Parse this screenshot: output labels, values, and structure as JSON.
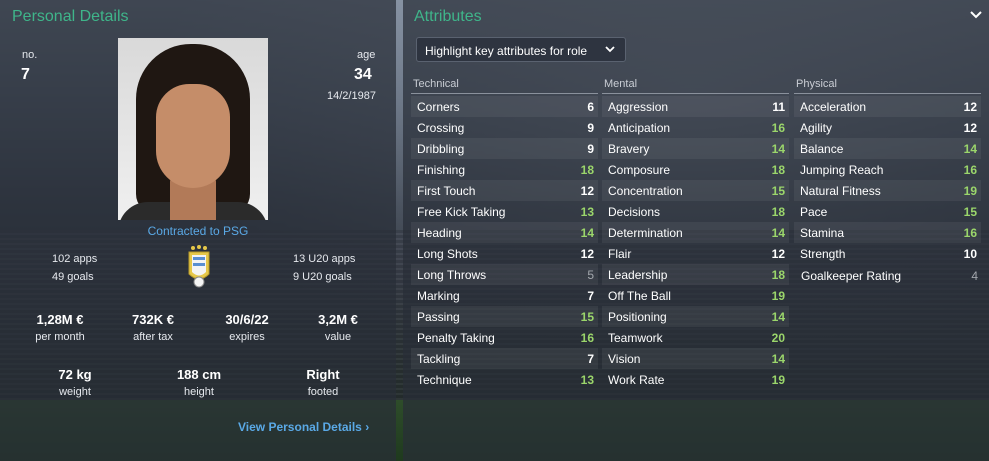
{
  "personal": {
    "title": "Personal Details",
    "number_label": "no.",
    "number": "7",
    "age_label": "age",
    "age": "34",
    "dob": "14/2/1987",
    "contract": "Contracted to PSG",
    "apps": "102 apps",
    "goals": "49 goals",
    "u20_apps": "13 U20 apps",
    "u20_goals": "9 U20 goals",
    "wage_value": "1,28M €",
    "wage_label": "per month",
    "aftertax_value": "732K €",
    "aftertax_label": "after tax",
    "expires_value": "30/6/22",
    "expires_label": "expires",
    "value_value": "3,2M €",
    "value_label": "value",
    "weight_value": "72 kg",
    "weight_label": "weight",
    "height_value": "188 cm",
    "height_label": "height",
    "footed_value": "Right",
    "footed_label": "footed",
    "view_link": "View Personal Details",
    "chevron": "›"
  },
  "attributes": {
    "title": "Attributes",
    "dropdown_label": "Highlight key attributes for role",
    "columns": [
      {
        "header": "Technical",
        "rows": [
          {
            "name": "Corners",
            "value": "6"
          },
          {
            "name": "Crossing",
            "value": "9"
          },
          {
            "name": "Dribbling",
            "value": "9"
          },
          {
            "name": "Finishing",
            "value": "18"
          },
          {
            "name": "First Touch",
            "value": "12"
          },
          {
            "name": "Free Kick Taking",
            "value": "13"
          },
          {
            "name": "Heading",
            "value": "14"
          },
          {
            "name": "Long Shots",
            "value": "12"
          },
          {
            "name": "Long Throws",
            "value": "5"
          },
          {
            "name": "Marking",
            "value": "7"
          },
          {
            "name": "Passing",
            "value": "15"
          },
          {
            "name": "Penalty Taking",
            "value": "16"
          },
          {
            "name": "Tackling",
            "value": "7"
          },
          {
            "name": "Technique",
            "value": "13"
          }
        ]
      },
      {
        "header": "Mental",
        "rows": [
          {
            "name": "Aggression",
            "value": "11"
          },
          {
            "name": "Anticipation",
            "value": "16"
          },
          {
            "name": "Bravery",
            "value": "14"
          },
          {
            "name": "Composure",
            "value": "18"
          },
          {
            "name": "Concentration",
            "value": "15"
          },
          {
            "name": "Decisions",
            "value": "18"
          },
          {
            "name": "Determination",
            "value": "14"
          },
          {
            "name": "Flair",
            "value": "12"
          },
          {
            "name": "Leadership",
            "value": "18"
          },
          {
            "name": "Off The Ball",
            "value": "19"
          },
          {
            "name": "Positioning",
            "value": "14"
          },
          {
            "name": "Teamwork",
            "value": "20"
          },
          {
            "name": "Vision",
            "value": "14"
          },
          {
            "name": "Work Rate",
            "value": "19"
          }
        ]
      },
      {
        "header": "Physical",
        "rows": [
          {
            "name": "Acceleration",
            "value": "12"
          },
          {
            "name": "Agility",
            "value": "12"
          },
          {
            "name": "Balance",
            "value": "14"
          },
          {
            "name": "Jumping Reach",
            "value": "16"
          },
          {
            "name": "Natural Fitness",
            "value": "19"
          },
          {
            "name": "Pace",
            "value": "15"
          },
          {
            "name": "Stamina",
            "value": "16"
          },
          {
            "name": "Strength",
            "value": "10"
          }
        ]
      }
    ],
    "goalkeeper_label": "Goalkeeper Rating",
    "goalkeeper_value": "4"
  },
  "colors": {
    "title_green": "#3fb58a",
    "highlight_green": "#9bd66b",
    "link_blue": "#5aa9e6",
    "panel": "#282e38"
  },
  "icons": {
    "collapse": "chevron-down-icon",
    "dropdown": "chevron-down-icon",
    "badge": "uruguay-federation-crest-icon"
  }
}
